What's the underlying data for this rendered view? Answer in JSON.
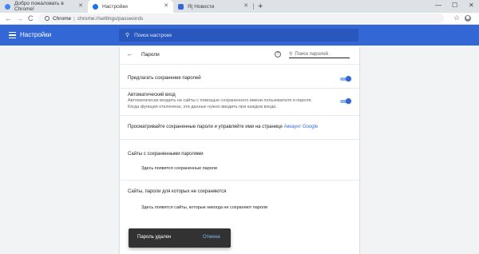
{
  "tabs": [
    {
      "title": "Добро пожаловать в Chrome!",
      "favicon_color": "#4285f4"
    },
    {
      "title": "Настройки",
      "favicon_color": "#1a73e8"
    },
    {
      "title": "Я| Новости",
      "favicon_color": "#3367d6"
    }
  ],
  "window_controls": {
    "minimize": "—",
    "maximize": "☐",
    "close": "✕"
  },
  "toolbar": {
    "back": "←",
    "forward": "→",
    "reload": "C",
    "url_host": "Chrome",
    "url_sep": "|",
    "url_path": "chrome://settings/passwords",
    "star": "☆"
  },
  "appbar": {
    "title": "Настройки",
    "search_placeholder": "Поиск настроек"
  },
  "passwords": {
    "back_arrow": "←",
    "title": "Пароли",
    "help": "?",
    "search_placeholder": "Поиск паролей",
    "offer_save_label": "Предлагать сохранение паролей",
    "offer_save_on": true,
    "autosignin_label": "Автоматический вход",
    "autosignin_desc_1": "Автоматически входить на сайты с помощью сохраненного имени пользователя и пароля.",
    "autosignin_desc_2": "Когда функция отключена, эти данные нужно вводить при каждом входе.",
    "autosignin_on": true,
    "manage_text": "Просматривайте сохраненные пароли и управляйте ими на странице",
    "manage_link": "Аккаунт Google",
    "saved_heading": "Сайты с сохраненными паролями",
    "saved_empty": "Здесь появятся сохраненные пароли",
    "never_heading": "Сайты, пароли для которых не сохраняются",
    "never_empty": "Здесь появятся сайты, которые никогда не сохраняют пароли"
  },
  "snackbar": {
    "message": "Пароль удален",
    "undo": "Отмена"
  },
  "colors": {
    "accent": "#3367d6",
    "tabstrip": "#dee1e6",
    "snackbar": "#323232"
  }
}
